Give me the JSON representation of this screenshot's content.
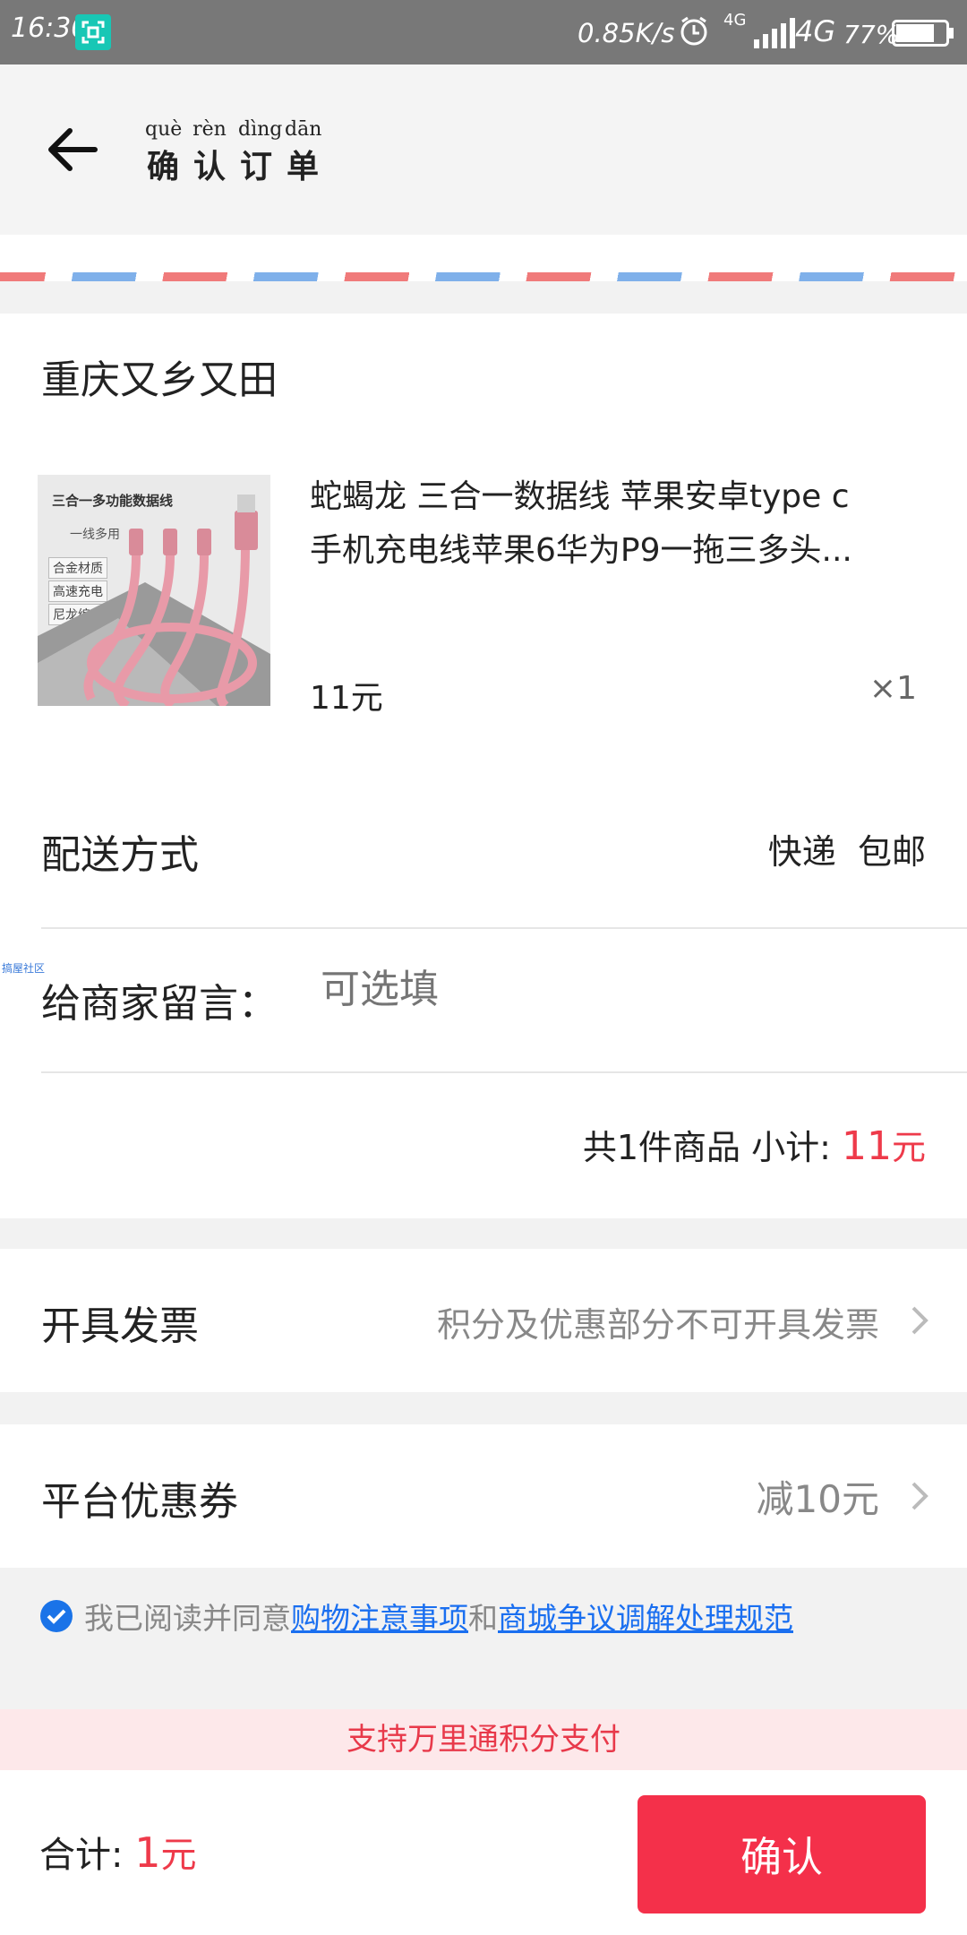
{
  "status_bar": {
    "time": "16:30",
    "net_speed": "0.85K/s",
    "small_network": "4G",
    "network": "4G",
    "battery": "77%"
  },
  "header": {
    "title_chars": [
      "确",
      "认",
      "订",
      "单"
    ],
    "pinyin": [
      "què",
      "rèn",
      "dìng",
      "dān"
    ],
    "back_icon": "arrow-left-icon"
  },
  "order": {
    "shop_name": "重庆又乡又田",
    "product": {
      "image_title": "三合一多功能数据线",
      "image_subtitle": "一线多用",
      "image_tags": [
        "合金材质",
        "高速充电",
        "尼龙编织"
      ],
      "name_line1": "蛇蝎龙 三合一数据线 苹果安卓type c",
      "name_line2": "手机充电线苹果6华为P9一拖三多头...",
      "price": "11元",
      "quantity": "×1"
    },
    "delivery": {
      "label": "配送方式",
      "method": "快递",
      "shipping": "包邮"
    },
    "message": {
      "label": "给商家留言：",
      "placeholder": "可选填"
    },
    "watermark": "搞屋社区",
    "subtotal": {
      "text": "共1件商品 小计:",
      "amount": "11",
      "unit": "元"
    }
  },
  "invoice": {
    "label": "开具发票",
    "hint": "积分及优惠部分不可开具发票"
  },
  "coupon": {
    "label": "平台优惠券",
    "value": "减10元"
  },
  "agreement": {
    "prefix": "我已阅读并同意",
    "link1": "购物注意事项",
    "middle": "和",
    "link2": "商城争议调解处理规范"
  },
  "points_notice": "支持万里通积分支付",
  "footer": {
    "total_label": "合计:",
    "total_amount": "1",
    "total_unit": "元",
    "confirm_label": "确认"
  },
  "colors": {
    "accent": "#f4304a",
    "price_red": "#ee3a4a",
    "link_blue": "#1a6ff0",
    "check_blue": "#1a73e8"
  }
}
